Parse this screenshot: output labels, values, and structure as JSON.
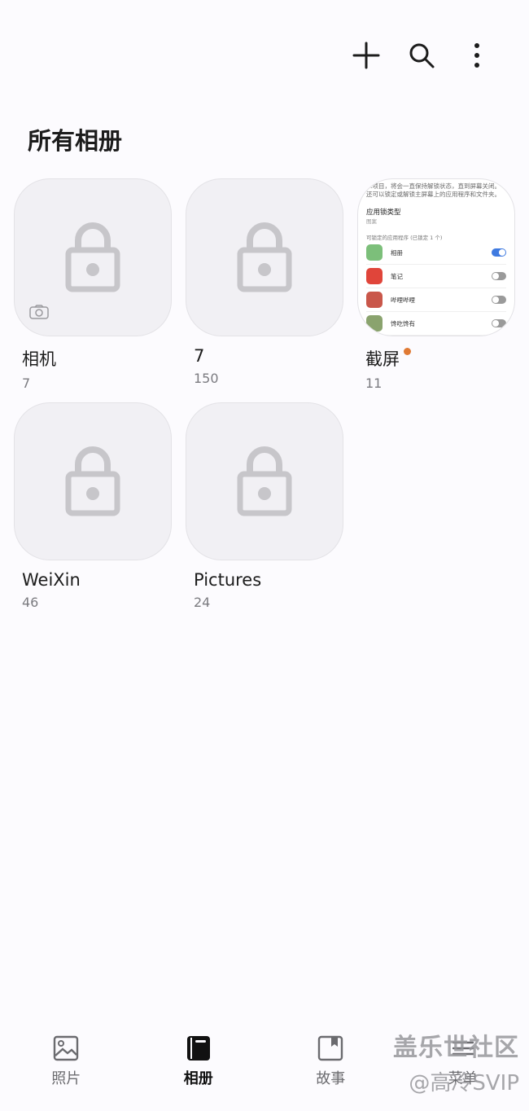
{
  "header": {
    "title": "所有相册",
    "actions": [
      {
        "name": "add-icon"
      },
      {
        "name": "search-icon"
      },
      {
        "name": "more-options-icon"
      }
    ]
  },
  "albums": [
    {
      "name": "相机",
      "count": "7",
      "locked": true,
      "camera_badge": true
    },
    {
      "name": "7",
      "count": "150",
      "locked": true
    },
    {
      "name": "截屏",
      "count": "11",
      "locked": false,
      "new_dot": true
    },
    {
      "name": "WeiXin",
      "count": "46",
      "locked": true
    },
    {
      "name": "Pictures",
      "count": "24",
      "locked": true
    }
  ],
  "screenshot_preview": {
    "lines": [
      "…项目，将会一直保持解锁状态，直到屏幕关闭。",
      "还可以锁定或解锁主屏幕上的应用程序和文件夹。"
    ],
    "section": "应用锁类型",
    "section_sub": "图案",
    "list_header": "可锁定的应用程序 (已锁定 1 个)",
    "apps": [
      {
        "label": "相册",
        "on": true,
        "color": "#7cbf7a"
      },
      {
        "label": "笔记",
        "on": false,
        "color": "#e0453a"
      },
      {
        "label": "哔哩哔哩",
        "on": false,
        "color": "#c9574a"
      },
      {
        "label": "馋吃馋有",
        "on": false,
        "color": "#8aa36e"
      }
    ]
  },
  "bottom_nav": [
    {
      "label": "照片",
      "icon": "photo-icon",
      "active": false
    },
    {
      "label": "相册",
      "icon": "album-icon",
      "active": true
    },
    {
      "label": "故事",
      "icon": "stories-icon",
      "active": false
    },
    {
      "label": "菜单",
      "icon": "menu-icon",
      "active": false
    }
  ],
  "watermark": {
    "line1": "盖乐世社区",
    "line2": "@高冷SVIP"
  },
  "colors": {
    "background": "#fcfbfe",
    "lock": "#c7c6ca",
    "accent_dot": "#e07a34",
    "toggle_on": "#3f7ae0"
  }
}
